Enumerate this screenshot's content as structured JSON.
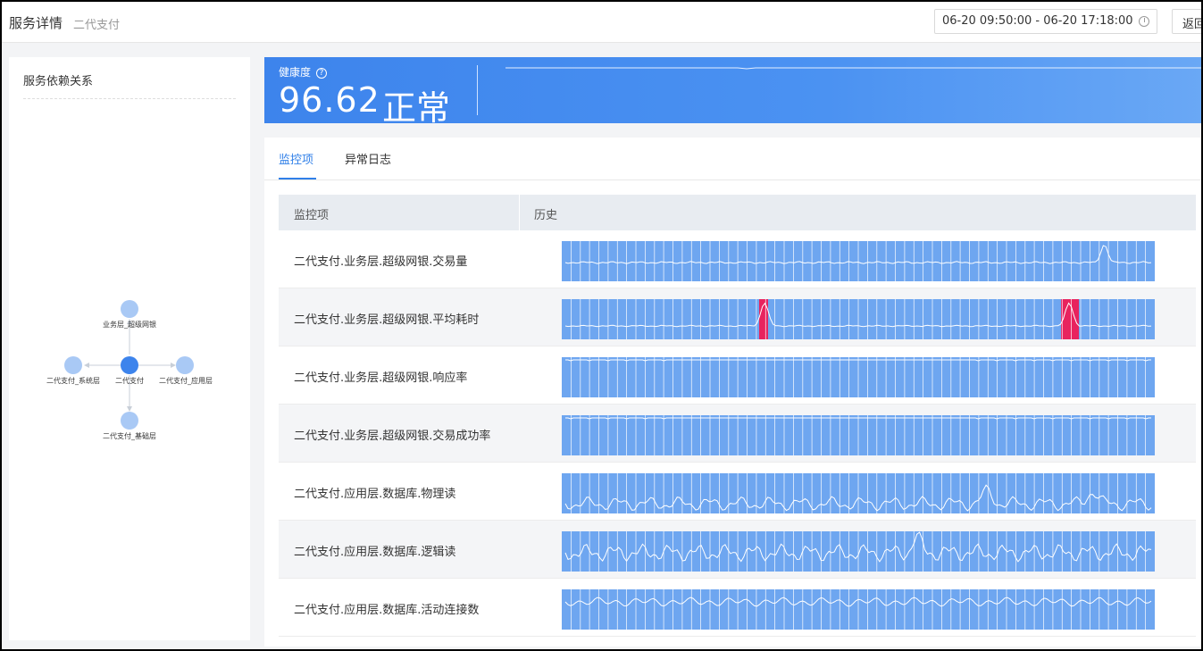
{
  "header": {
    "title": "服务详情",
    "subtitle": "二代支付",
    "daterange": "06-20 09:50:00 - 06-20 17:18:00",
    "back_label": "返回"
  },
  "dependency": {
    "title": "服务依赖关系",
    "nodes": [
      {
        "id": "top",
        "label": "业务层_超级网银"
      },
      {
        "id": "center",
        "label": "二代支付"
      },
      {
        "id": "left",
        "label": "二代支付_系统层"
      },
      {
        "id": "right",
        "label": "二代支付_应用层"
      },
      {
        "id": "bottom",
        "label": "二代支付_基础层"
      }
    ]
  },
  "health": {
    "label": "健康度",
    "score": "96.62",
    "status": "正常",
    "help_icon": "help-circle-icon"
  },
  "tabs": [
    {
      "label": "监控项",
      "active": true
    },
    {
      "label": "异常日志",
      "active": false
    }
  ],
  "table": {
    "headers": [
      "监控项",
      "历史"
    ],
    "rows": [
      {
        "name": "二代支付.业务层.超级网银.交易量",
        "pattern": "flat_peak",
        "alerts": []
      },
      {
        "name": "二代支付.业务层.超级网银.平均耗时",
        "pattern": "spikes",
        "alerts": [
          0.34,
          0.85
        ]
      },
      {
        "name": "二代支付.业务层.超级网银.响应率",
        "pattern": "top_flat",
        "alerts": []
      },
      {
        "name": "二代支付.业务层.超级网银.交易成功率",
        "pattern": "top_flat",
        "alerts": []
      },
      {
        "name": "二代支付.应用层.数据库.物理读",
        "pattern": "wavy",
        "alerts": []
      },
      {
        "name": "二代支付.应用层.数据库.逻辑读",
        "pattern": "wavy2",
        "alerts": []
      },
      {
        "name": "二代支付.应用层.数据库.活动连接数",
        "pattern": "wavy3",
        "alerts": []
      }
    ]
  },
  "colors": {
    "accent": "#2f7fe8",
    "spark_bg": "#6ea6f0",
    "alert": "#e8235e"
  }
}
